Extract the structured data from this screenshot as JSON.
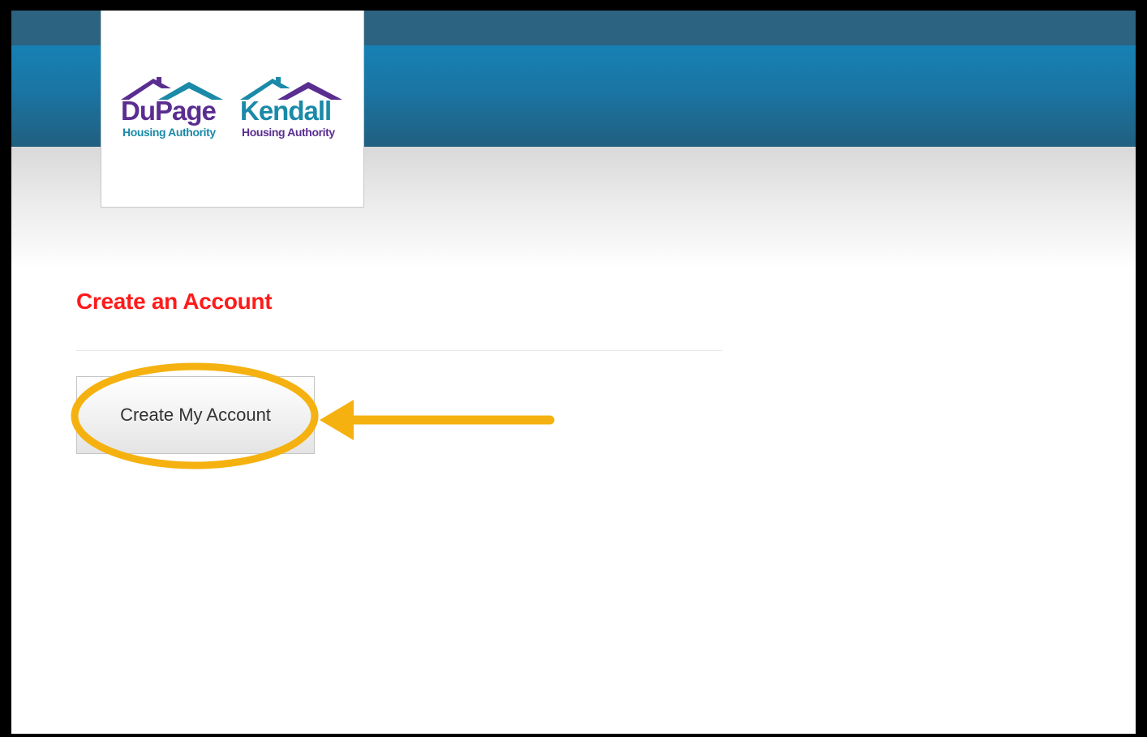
{
  "logos": {
    "dupage": {
      "name": "DuPage",
      "subtitle": "Housing Authority"
    },
    "kendall": {
      "name": "Kendall",
      "subtitle": "Housing Authority"
    }
  },
  "page": {
    "title": "Create an Account",
    "button_label": "Create My Account"
  },
  "colors": {
    "header_top": "#2c6380",
    "header_main": "#1781b5",
    "title": "#ff1a1a",
    "annotation": "#f5b10f",
    "logo_purple": "#5a2d91",
    "logo_teal": "#1a8aa8"
  },
  "annotation": {
    "shape": "ellipse-highlight",
    "pointer": "arrow-left",
    "target": "Create My Account"
  }
}
